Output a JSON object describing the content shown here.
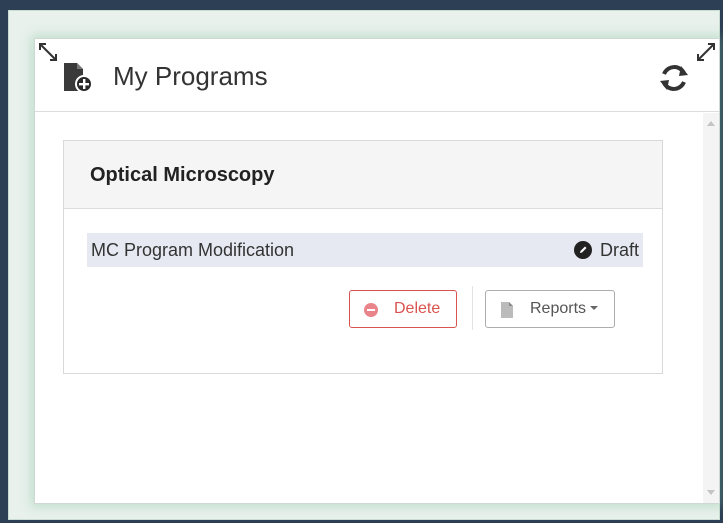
{
  "widget": {
    "title": "My Programs",
    "icons": {
      "title": "file-plus-icon",
      "refresh": "refresh-icon",
      "resize_left": "resize-diagonal-icon",
      "resize_right": "resize-diagonal-icon"
    }
  },
  "group": {
    "title": "Optical Microscopy",
    "programs": [
      {
        "name": "MC Program Modification",
        "status": "Draft",
        "status_icon": "pencil-circle-icon",
        "actions": {
          "delete_label": "Delete",
          "reports_label": "Reports"
        }
      }
    ]
  },
  "colors": {
    "delete": "#d9534f",
    "row_highlight": "#e6e9f2",
    "glow": "#78be96"
  }
}
